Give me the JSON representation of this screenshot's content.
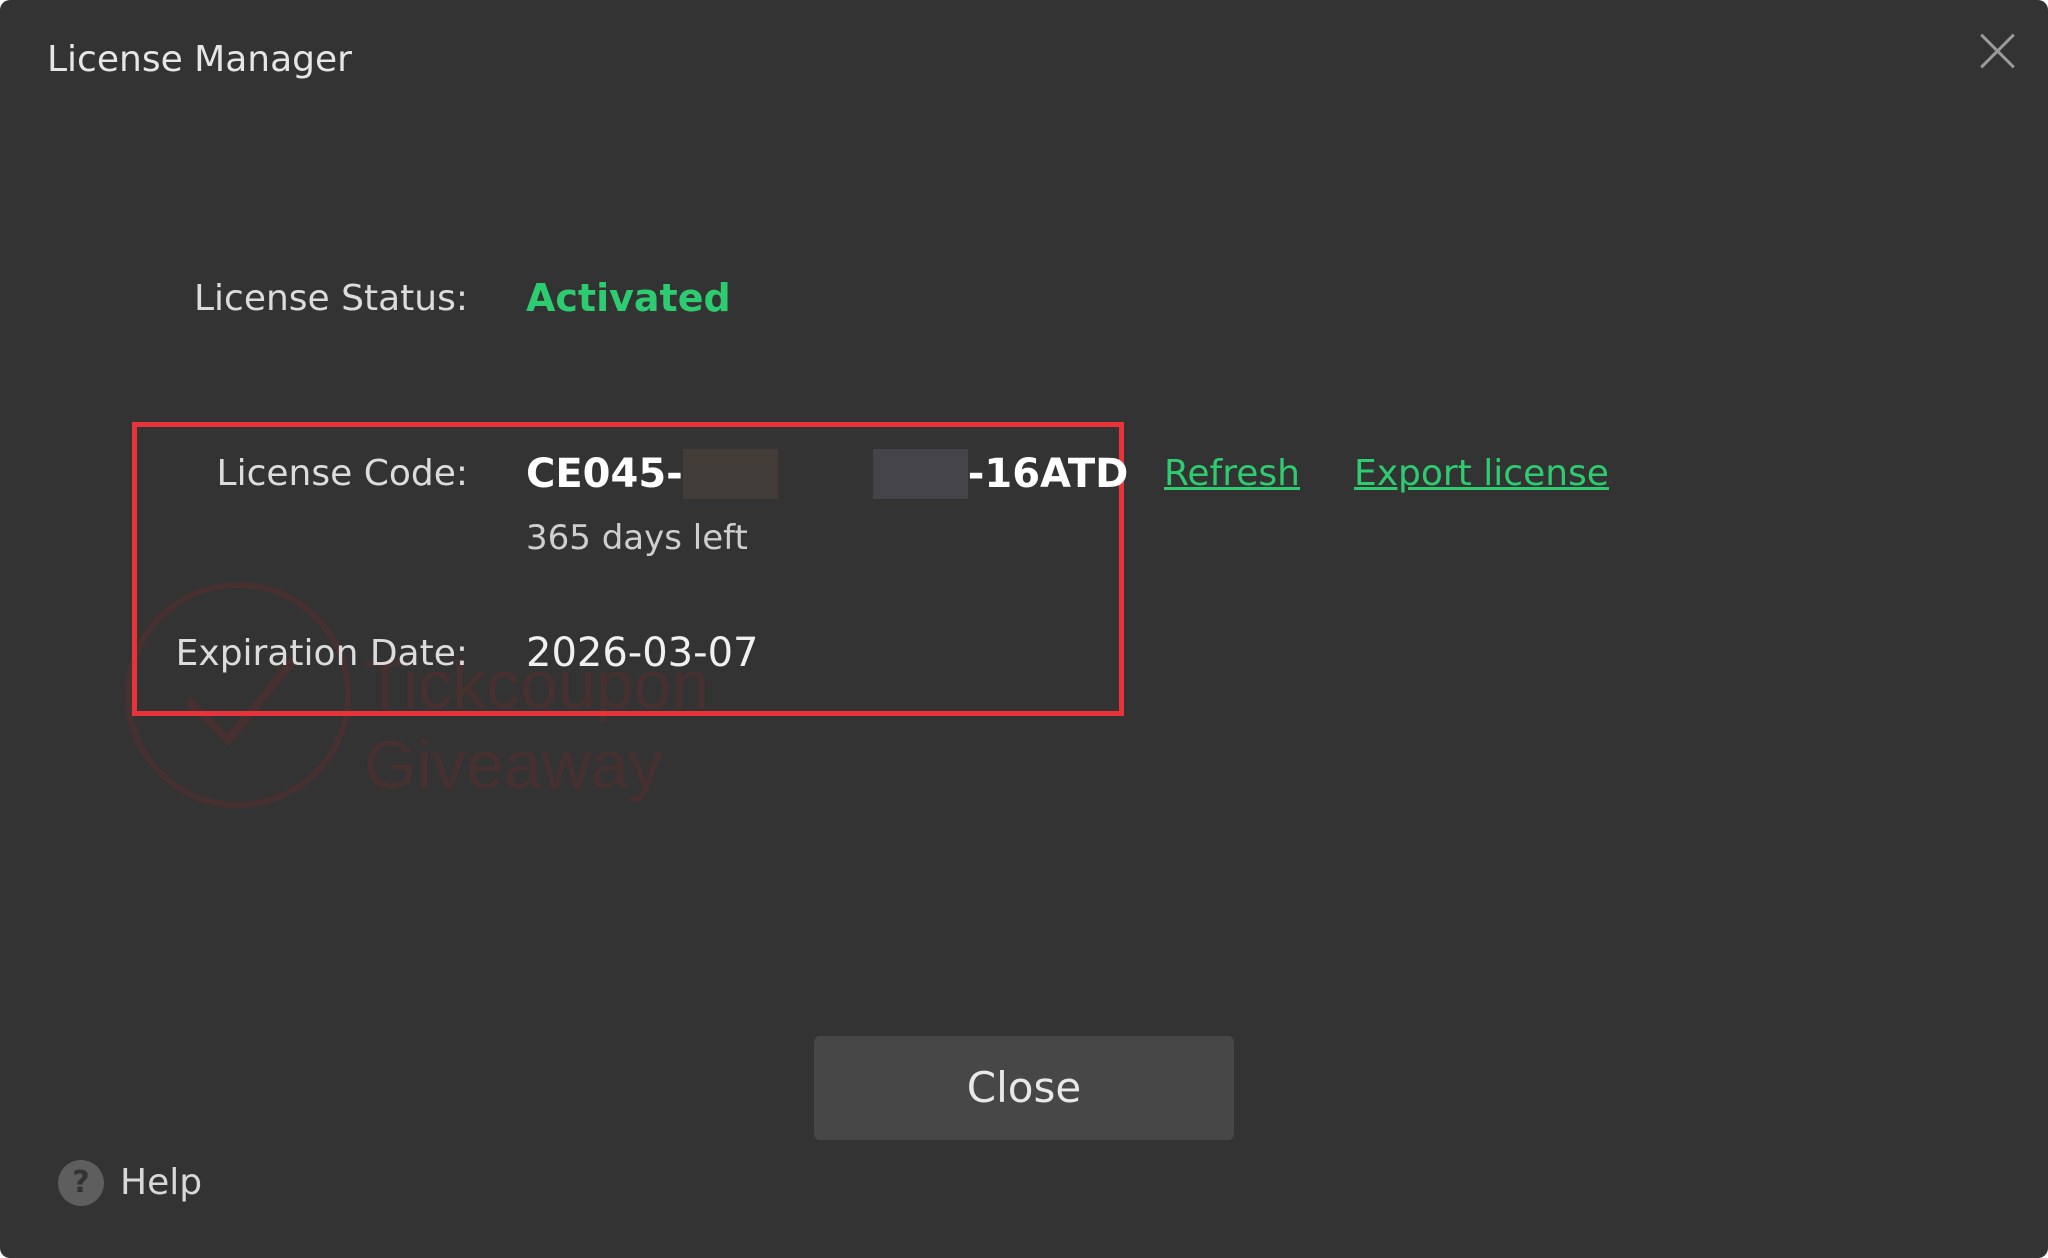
{
  "window": {
    "title": "License Manager",
    "close_icon": "close-icon"
  },
  "watermark": {
    "line1": "Tickcoupon",
    "line2": "Giveaway"
  },
  "license": {
    "status_label": "License Status:",
    "status_value": "Activated",
    "code_label": "License Code:",
    "code_prefix": "CE045-",
    "code_suffix": "-16ATD",
    "days_left": "365 days left",
    "expiration_label": "Expiration Date:",
    "expiration_value": "2026-03-07"
  },
  "actions": {
    "refresh_label": "Refresh",
    "export_label": "Export license",
    "close_label": "Close"
  },
  "footer": {
    "help_icon": "?",
    "help_label": "Help"
  },
  "colors": {
    "background": "#333333",
    "accent_green": "#2ecc71",
    "highlight_red": "#e8333a"
  }
}
